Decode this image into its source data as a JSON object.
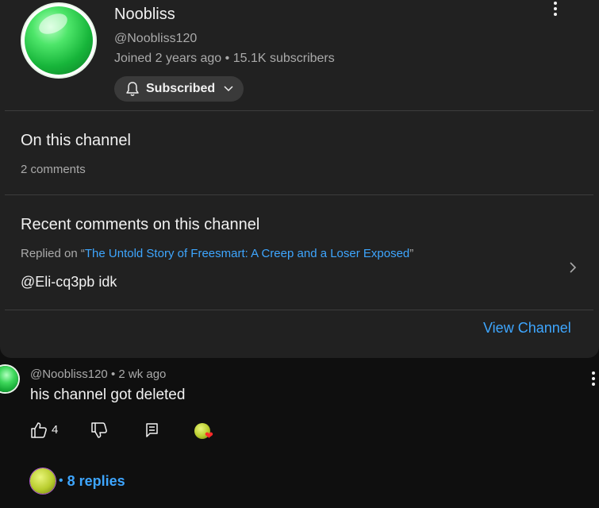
{
  "channel": {
    "name": "Noobliss",
    "handle": "@Noobliss120",
    "meta": "Joined 2 years ago • 15.1K subscribers",
    "subscribe_label": "Subscribed"
  },
  "on_channel": {
    "heading": "On this channel",
    "count_text": "2 comments"
  },
  "recent": {
    "heading": "Recent comments on this channel",
    "replied_prefix": "Replied on “",
    "video_title": "The Untold Story of Freesmart: A Creep and a Loser Exposed",
    "replied_suffix": "”",
    "reply_text": "@Eli-cq3pb idk"
  },
  "view_channel_label": "View Channel",
  "comment": {
    "meta": "@Noobliss120 • 2 wk ago",
    "text": "his channel got deleted",
    "likes": "4",
    "replies_label": "8 replies",
    "bullet": "•"
  },
  "colors": {
    "link": "#3ea6ff",
    "card_bg": "#212121",
    "page_bg": "#0f0f0f",
    "heart": "#ff2a2a"
  },
  "icons": [
    "bell-icon",
    "chevron-down-icon",
    "chevron-right-icon",
    "more-vert-icon",
    "thumb-up-icon",
    "thumb-down-icon",
    "comment-reply-icon",
    "heart-icon"
  ]
}
